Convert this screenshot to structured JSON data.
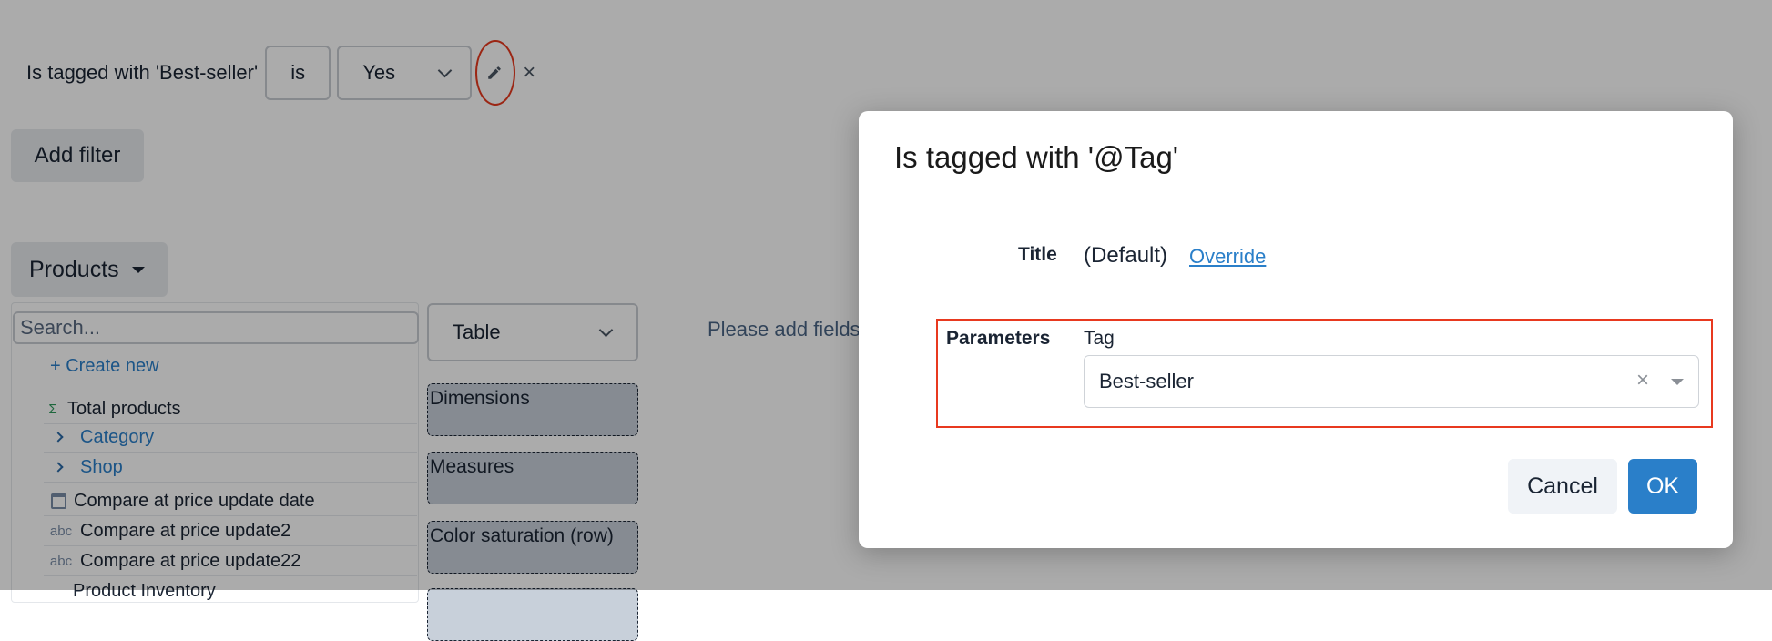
{
  "filter": {
    "label": "Is tagged with 'Best-seller'",
    "operator": "is",
    "value": "Yes",
    "edit_icon": "pencil-icon",
    "remove_icon": "close-icon",
    "remove_glyph": "×"
  },
  "add_filter_label": "Add filter",
  "products_button_label": "Products",
  "field_list": {
    "search_placeholder": "Search...",
    "create_new_label": "+ Create new",
    "items": [
      {
        "type": "measure",
        "icon": "sigma-icon",
        "glyph": "Σ",
        "label": "Total products"
      },
      {
        "type": "folder",
        "icon": "chevron-right-icon",
        "label": "Category"
      },
      {
        "type": "folder",
        "icon": "chevron-right-icon",
        "label": "Shop"
      },
      {
        "type": "date",
        "icon": "calendar-icon",
        "label": "Compare at price update date"
      },
      {
        "type": "text",
        "icon": "abc-icon",
        "glyph": "abc",
        "label": "Compare at price update2"
      },
      {
        "type": "text",
        "icon": "abc-icon",
        "glyph": "abc",
        "label": "Compare at price update22"
      },
      {
        "type": "text",
        "icon": "",
        "label": "Product Inventory"
      }
    ]
  },
  "visualization": {
    "selected": "Table",
    "drop_zones": [
      "Dimensions",
      "Measures",
      "Color saturation (row)"
    ]
  },
  "hint_text": "Please add fields",
  "modal": {
    "title": "Is tagged with '@Tag'",
    "title_row_label": "Title",
    "title_default": "(Default)",
    "override_link": "Override",
    "parameters_label": "Parameters",
    "tag_label": "Tag",
    "tag_value": "Best-seller",
    "clear_glyph": "×",
    "cancel_label": "Cancel",
    "ok_label": "OK"
  },
  "colors": {
    "accent": "#2a7fc9",
    "highlight": "#e8391f",
    "measure_icon": "#2e9a5c"
  }
}
